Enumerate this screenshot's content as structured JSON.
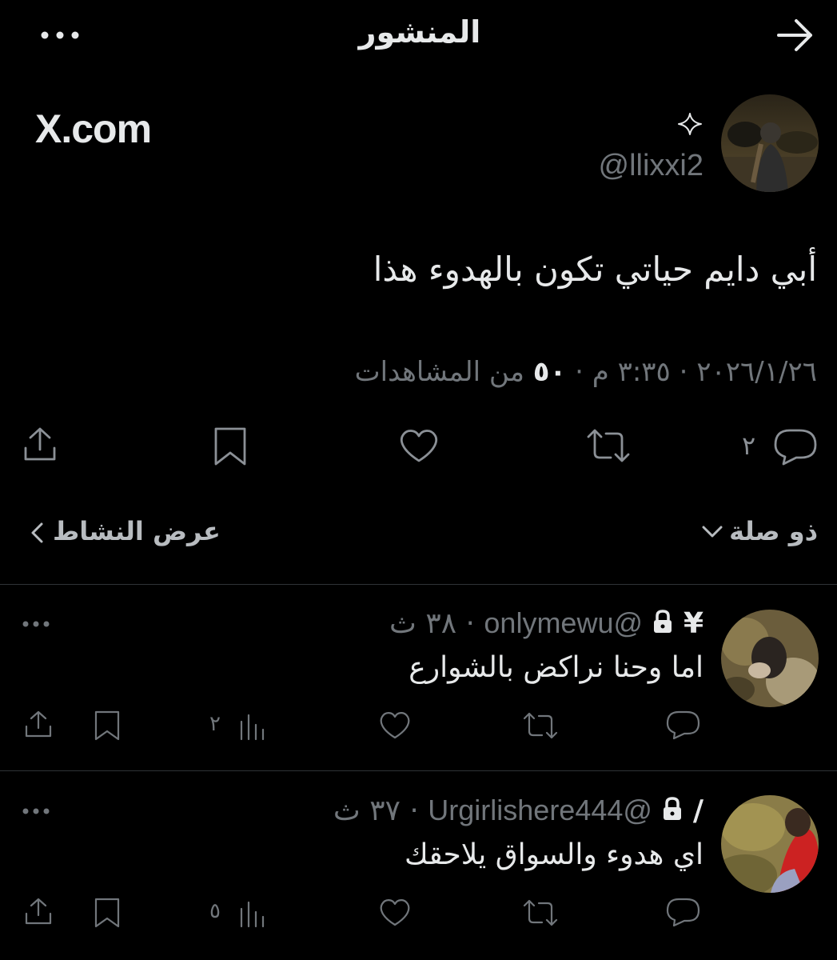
{
  "header": {
    "title": "المنشور",
    "back_icon": "arrow-right-icon",
    "more_icon": "more-horizontal-icon"
  },
  "post": {
    "source": "X.com",
    "handle": "@llixxi2",
    "badge_icon": "sparkle-icon",
    "text": "أبي دايم حياتي تكون بالهدوء هذا",
    "date": "٢٠٢٦/١/٢٦",
    "time": "٣:٣٥ م",
    "views_count": "٥٠",
    "views_label": "من المشاهدات",
    "actions": {
      "reply_count": "٢",
      "reply_icon": "comment-icon",
      "repost_icon": "repost-icon",
      "like_icon": "heart-icon",
      "bookmark_icon": "bookmark-icon",
      "share_icon": "share-icon"
    },
    "sort_label": "ذو صلة",
    "activity_label": "عرض النشاط"
  },
  "replies": [
    {
      "handle": "@onlymewu",
      "prefix": "¥",
      "age": "٣٨ ث",
      "text": "اما وحنا نراكض بالشوارع",
      "views": "٢"
    },
    {
      "handle": "@Urgirlishere444",
      "prefix": "/",
      "age": "٣٧ ث",
      "text": "اي هدوء والسواق يلاحقك",
      "views": "٥"
    }
  ],
  "colors": {
    "background": "#000000",
    "text": "#e7e9ea",
    "muted": "#71767b",
    "divider": "#2f3336"
  }
}
